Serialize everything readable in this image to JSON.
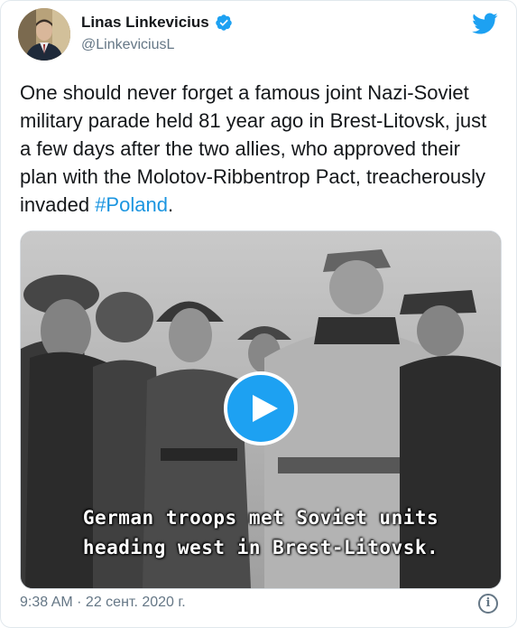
{
  "author": {
    "display_name": "Linas Linkevicius",
    "handle": "@LinkeviciusL",
    "verified": true
  },
  "icons": {
    "brand": "twitter-bird-icon",
    "verified": "verified-badge-icon",
    "play": "play-icon",
    "info": "info-icon"
  },
  "tweet": {
    "text_before": "One should never forget a famous joint Nazi-Soviet military parade held 81 year ago in Brest-Litovsk, just a few days after the two allies, who approved their plan with the Molotov-Ribbentrop Pact, treacherously invaded ",
    "hashtag": "#Poland",
    "text_after": "."
  },
  "media": {
    "type": "video",
    "subtitle_line_1": "German troops met Soviet units",
    "subtitle_line_2": "heading west in Brest-Litovsk."
  },
  "footer": {
    "timestamp": "9:38 AM · 22 сент. 2020 г.",
    "info_glyph": "i"
  },
  "colors": {
    "accent": "#1da1f2",
    "hashtag": "#1b95e0",
    "secondary_text": "#657786"
  }
}
